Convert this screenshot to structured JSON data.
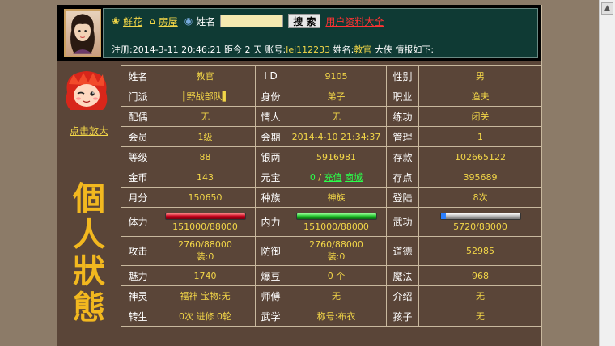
{
  "header": {
    "flower_label": "鲜花",
    "house_label": "房屋",
    "name_label": "姓名",
    "name_value": "",
    "search_label": "搜 索",
    "all_users_label": "用户资料大全",
    "reg_prefix": "注册:",
    "reg_date": "2014-3-11 20:46:21",
    "days_ago_prefix": "距今",
    "days_ago": "2",
    "days_unit": "天",
    "account_label": "账号:",
    "account": "lei112233",
    "name_prefix": "姓名:",
    "name": "教官",
    "suffix": "大侠 情报如下:"
  },
  "side": {
    "enlarge_label": "点击放大",
    "title_chars": [
      "個",
      "人",
      "狀",
      "態"
    ]
  },
  "stats": {
    "r1": {
      "k1": "姓名",
      "v1": "教官",
      "k2": "I D",
      "v2": "9105",
      "k3": "性别",
      "v3": "男"
    },
    "r2": {
      "k1": "门派",
      "v1": "┃野战部队▌",
      "k2": "身份",
      "v2": "弟子",
      "k3": "职业",
      "v3": "渔夫"
    },
    "r3": {
      "k1": "配偶",
      "v1": "无",
      "k2": "情人",
      "v2": "无",
      "k3": "练功",
      "v3": "闭关"
    },
    "r4": {
      "k1": "会员",
      "v1": "1级",
      "k2": "会期",
      "v2": "2014-4-10 21:34:37",
      "k3": "管理",
      "v3": "1"
    },
    "r5": {
      "k1": "等级",
      "v1": "88",
      "k2": "银两",
      "v2": "5916981",
      "k3": "存款",
      "v3": "102665122"
    },
    "r6": {
      "k1": "金币",
      "v1": "143",
      "k2": "元宝",
      "v2": "0",
      "v2_sep": "/",
      "v2_link1": "充值",
      "v2_link2": "商城",
      "k3": "存点",
      "v3": "395689"
    },
    "r7": {
      "k1": "月分",
      "v1": "150650",
      "k2": "种族",
      "v2": "神族",
      "k3": "登陆",
      "v3": "8次"
    },
    "r8": {
      "k1": "体力",
      "v1": "151000/88000",
      "k2": "内力",
      "v2": "151000/88000",
      "k3": "武功",
      "v3": "5720/88000"
    },
    "r9": {
      "k1": "攻击",
      "v1a": "2760/88000",
      "v1b": "装:0",
      "k2": "防御",
      "v2a": "2760/88000",
      "v2b": "装:0",
      "k3": "道德",
      "v3": "52985"
    },
    "r10": {
      "k1": "魅力",
      "v1": "1740",
      "k2": "爆豆",
      "v2": "0 个",
      "k3": "魔法",
      "v3": "968"
    },
    "r11": {
      "k1": "神灵",
      "v1a": "福神",
      "v1b": "宝物:无",
      "k2": "师傅",
      "v2": "无",
      "k3": "介绍",
      "v3": "无"
    },
    "r12": {
      "k1": "转生",
      "v1a": "0次",
      "v1b": "进修",
      "v1c": "0轮",
      "k2": "武学",
      "v2": "称号:布衣",
      "k3": "孩子",
      "v3": "无"
    }
  },
  "bars": {
    "hp_fraction": 1.0,
    "mp_fraction": 1.0,
    "skill_fraction": 0.065
  },
  "colors": {
    "text_yellow": "#f2d648",
    "link_red": "#ff3333",
    "link_green": "#2aff4a",
    "panel_bg": "#5a4538"
  }
}
